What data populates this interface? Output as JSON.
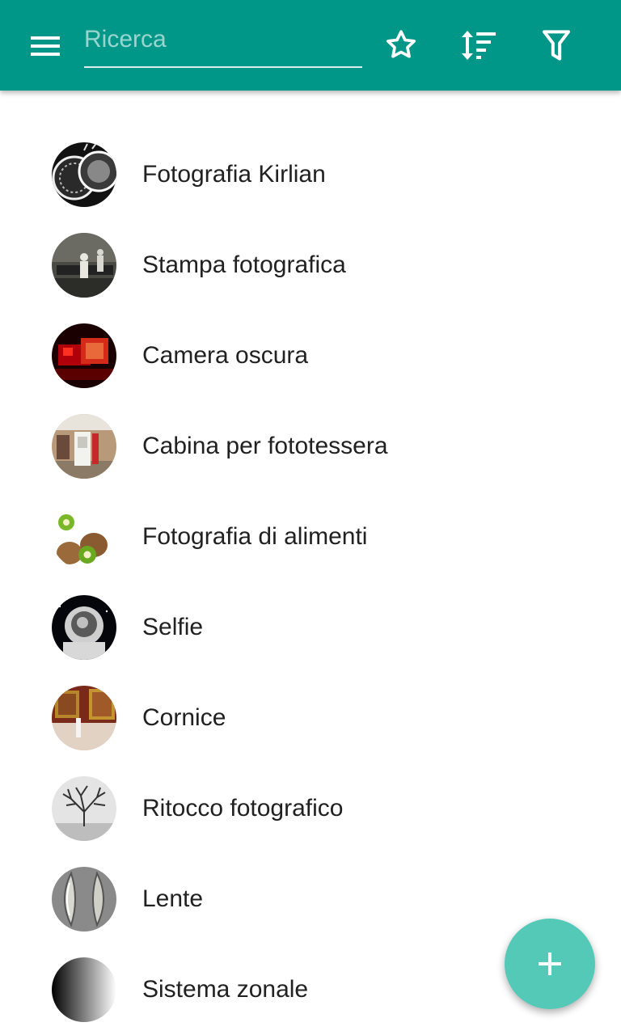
{
  "toolbar": {
    "menu_icon": "hamburger-menu-icon",
    "search": {
      "placeholder": "Ricerca",
      "value": ""
    },
    "actions": [
      {
        "name": "favorites",
        "icon": "star-outline-icon"
      },
      {
        "name": "sort",
        "icon": "sort-icon"
      },
      {
        "name": "filter",
        "icon": "filter-icon"
      }
    ],
    "background_color": "#009688"
  },
  "items": [
    {
      "label": "Fotografia Kirlian"
    },
    {
      "label": "Stampa fotografica"
    },
    {
      "label": "Camera oscura"
    },
    {
      "label": "Cabina per fototessera"
    },
    {
      "label": "Fotografia di alimenti"
    },
    {
      "label": "Selfie"
    },
    {
      "label": "Cornice"
    },
    {
      "label": "Ritocco fotografico"
    },
    {
      "label": "Lente"
    },
    {
      "label": "Sistema zonale"
    }
  ],
  "fab": {
    "icon": "plus-icon",
    "color": "#55c9b8"
  }
}
